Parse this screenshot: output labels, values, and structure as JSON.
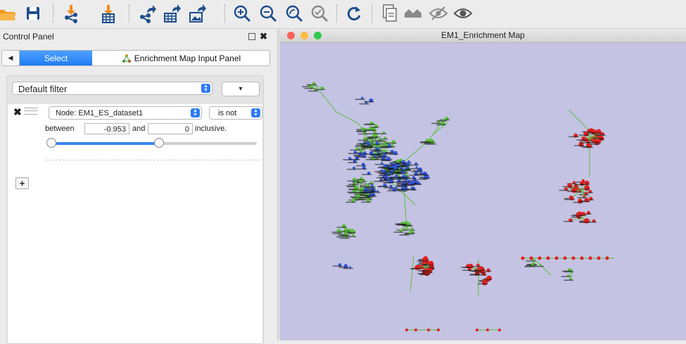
{
  "toolbar": {
    "icons": [
      "open-folder-icon",
      "save-icon",
      "import-network-icon",
      "import-table-icon",
      "export-network-icon",
      "export-table-icon",
      "export-image-icon",
      "zoom-in-icon",
      "zoom-out-icon",
      "zoom-fit-icon",
      "zoom-selected-icon",
      "refresh-icon",
      "new-session-icon",
      "show-hidden-icon",
      "hide-icon",
      "show-icon"
    ]
  },
  "control_panel": {
    "title": "Control Panel",
    "tabs": {
      "select": "Select",
      "enrichment": "Enrichment Map Input Panel"
    },
    "filter": {
      "preset": "Default filter",
      "column": "Node: EM1_ES_dataset1",
      "operator": "is not",
      "between_label": "between",
      "min": "-0.953",
      "and_label": "and",
      "max": "0",
      "inclusive_label": "inclusive.",
      "options_glyph": "▾"
    }
  },
  "network": {
    "title": "EM1_Enrichment Map",
    "colors": {
      "background": "#c4c3e3",
      "edge": "#5cbf3c",
      "cluster_blue": "#2f55d6",
      "cluster_red": "#e02020"
    }
  }
}
